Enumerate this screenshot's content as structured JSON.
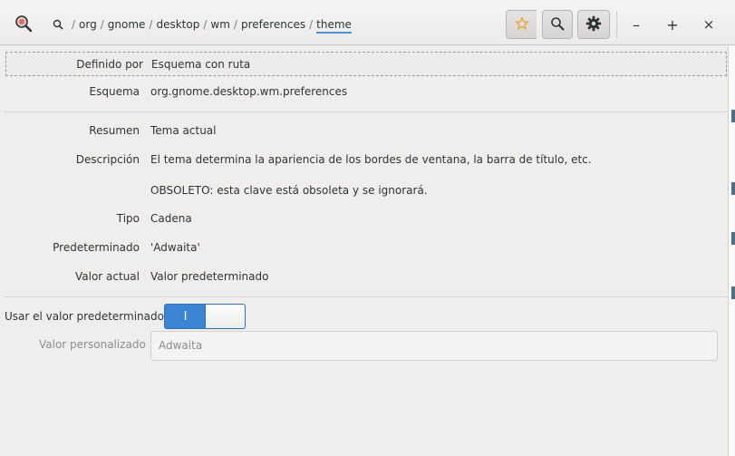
{
  "header": {
    "path_segments": [
      "org",
      "gnome",
      "desktop",
      "wm",
      "preferences",
      "theme"
    ],
    "path_separator": "/",
    "icons": {
      "app": "dconf-magnifier-icon",
      "root": "search-small-icon",
      "bookmark": "star-icon",
      "search": "search-icon",
      "menu": "gear-icon",
      "minimize": "minimize-icon",
      "maximize": "maximize-icon",
      "close": "close-icon"
    },
    "window_buttons": {
      "minimize": "–",
      "maximize": "+",
      "close": "×"
    },
    "accent": "#4a90d9",
    "star_color": "#e8a534"
  },
  "details": {
    "defined_by": {
      "label": "Definido por",
      "value": "Esquema con ruta"
    },
    "schema": {
      "label": "Esquema",
      "value": "org.gnome.desktop.wm.preferences"
    },
    "summary": {
      "label": "Resumen",
      "value": "Tema actual"
    },
    "description": {
      "label": "Descripción",
      "value": "El tema determina la apariencia de los bordes de ventana, la barra de título, etc.",
      "note": "OBSOLETO: esta clave está obsoleta y se ignorará."
    },
    "type": {
      "label": "Tipo",
      "value": "Cadena"
    },
    "default": {
      "label": "Predeterminado",
      "value": "'Adwaita'"
    },
    "current": {
      "label": "Valor actual",
      "value": "Valor predeterminado"
    }
  },
  "controls": {
    "use_default": {
      "label": "Usar el valor predeterminado",
      "on_glyph": "I",
      "state": "on"
    },
    "custom_value": {
      "label": "Valor personalizado",
      "placeholder": "Adwaita"
    },
    "switch_color": "#3b84d4"
  }
}
